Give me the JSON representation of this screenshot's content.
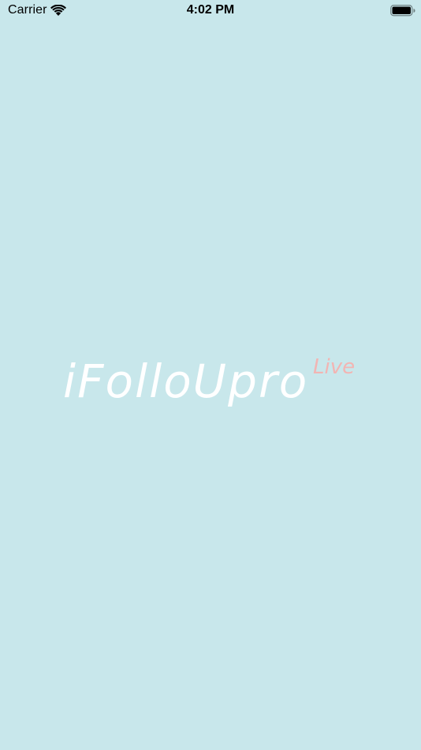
{
  "status_bar": {
    "carrier": "Carrier",
    "time": "4:02 PM",
    "icons": [
      "wifi-icon",
      "battery-icon"
    ]
  },
  "splash": {
    "logo_text": "iFolloUpro",
    "logo_superscript": "Live"
  },
  "colors": {
    "background": "#c8e7eb",
    "logo_text": "#ffffff",
    "logo_superscript": "#f2b5b3"
  }
}
